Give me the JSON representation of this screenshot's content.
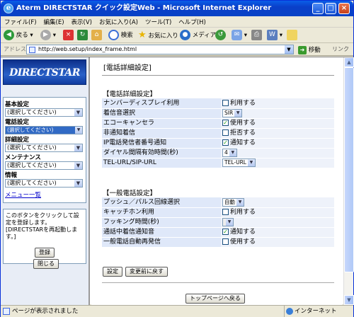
{
  "window": {
    "title": "Aterm DIRECTSTAR クイック設定Web - Microsoft Internet Explorer"
  },
  "menubar": [
    "ファイル(F)",
    "編集(E)",
    "表示(V)",
    "お気に入り(A)",
    "ツール(T)",
    "ヘルプ(H)"
  ],
  "toolbar": {
    "back": "戻る",
    "search": "検索",
    "favorites": "お気に入り",
    "media": "メディア"
  },
  "address": {
    "label": "アドレス(D)",
    "url": "http://web.setup/index_frame.html",
    "go": "移動",
    "links": "リンク"
  },
  "left": {
    "logo": "DIRECTSTAR",
    "nav": [
      {
        "label": "基本設定",
        "value": "(選択してください)"
      },
      {
        "label": "電話設定",
        "value": "(選択してください)"
      },
      {
        "label": "詳細設定",
        "value": "(選択してください)"
      },
      {
        "label": "メンテナンス",
        "value": "(選択してください)"
      },
      {
        "label": "情報",
        "value": "(選択してください)"
      }
    ],
    "menu_link": "メニュー一覧",
    "note": "このボタンをクリックして設定を登録します。[DIRECTSTARを再起動します。]",
    "register": "登録",
    "close": "閉じる"
  },
  "main": {
    "page_title": "[電話詳細設定]",
    "section1": {
      "title": "【電話詳細設定】",
      "rows": [
        {
          "label": "ナンバーディスプレイ利用",
          "type": "check",
          "checked": false,
          "text": "利用する"
        },
        {
          "label": "着信音選択",
          "type": "select",
          "value": "SIR"
        },
        {
          "label": "エコーキャンセラ",
          "type": "check",
          "checked": true,
          "text": "使用する"
        },
        {
          "label": "非通知着信",
          "type": "check",
          "checked": false,
          "text": "拒否する"
        },
        {
          "label": "IP電話発信者番号通知",
          "type": "check",
          "checked": true,
          "text": "通知する"
        },
        {
          "label": "ダイヤル間隔有効時間(秒)",
          "type": "select",
          "value": "4"
        },
        {
          "label": "TEL-URL/SIP-URL",
          "type": "select",
          "value": "TEL-URL"
        }
      ]
    },
    "section2": {
      "title": "【一般電話設定】",
      "rows": [
        {
          "label": "プッシュ／パルス回線選択",
          "type": "select",
          "value": "自動"
        },
        {
          "label": "キャッチホン利用",
          "type": "check",
          "checked": false,
          "text": "利用する"
        },
        {
          "label": "フッキング時間(秒)",
          "type": "select",
          "value": "",
          "disabled": true
        },
        {
          "label": "通話中着信通知音",
          "type": "check",
          "checked": true,
          "text": "通知する"
        },
        {
          "label": "一般電話自動再発信",
          "type": "check",
          "checked": false,
          "text": "使用する"
        }
      ]
    },
    "set_btn": "設定",
    "revert_btn": "変更前に戻す",
    "top_btn": "トップページへ戻る"
  },
  "status": {
    "text": "ページが表示されました",
    "zone": "インターネット"
  }
}
